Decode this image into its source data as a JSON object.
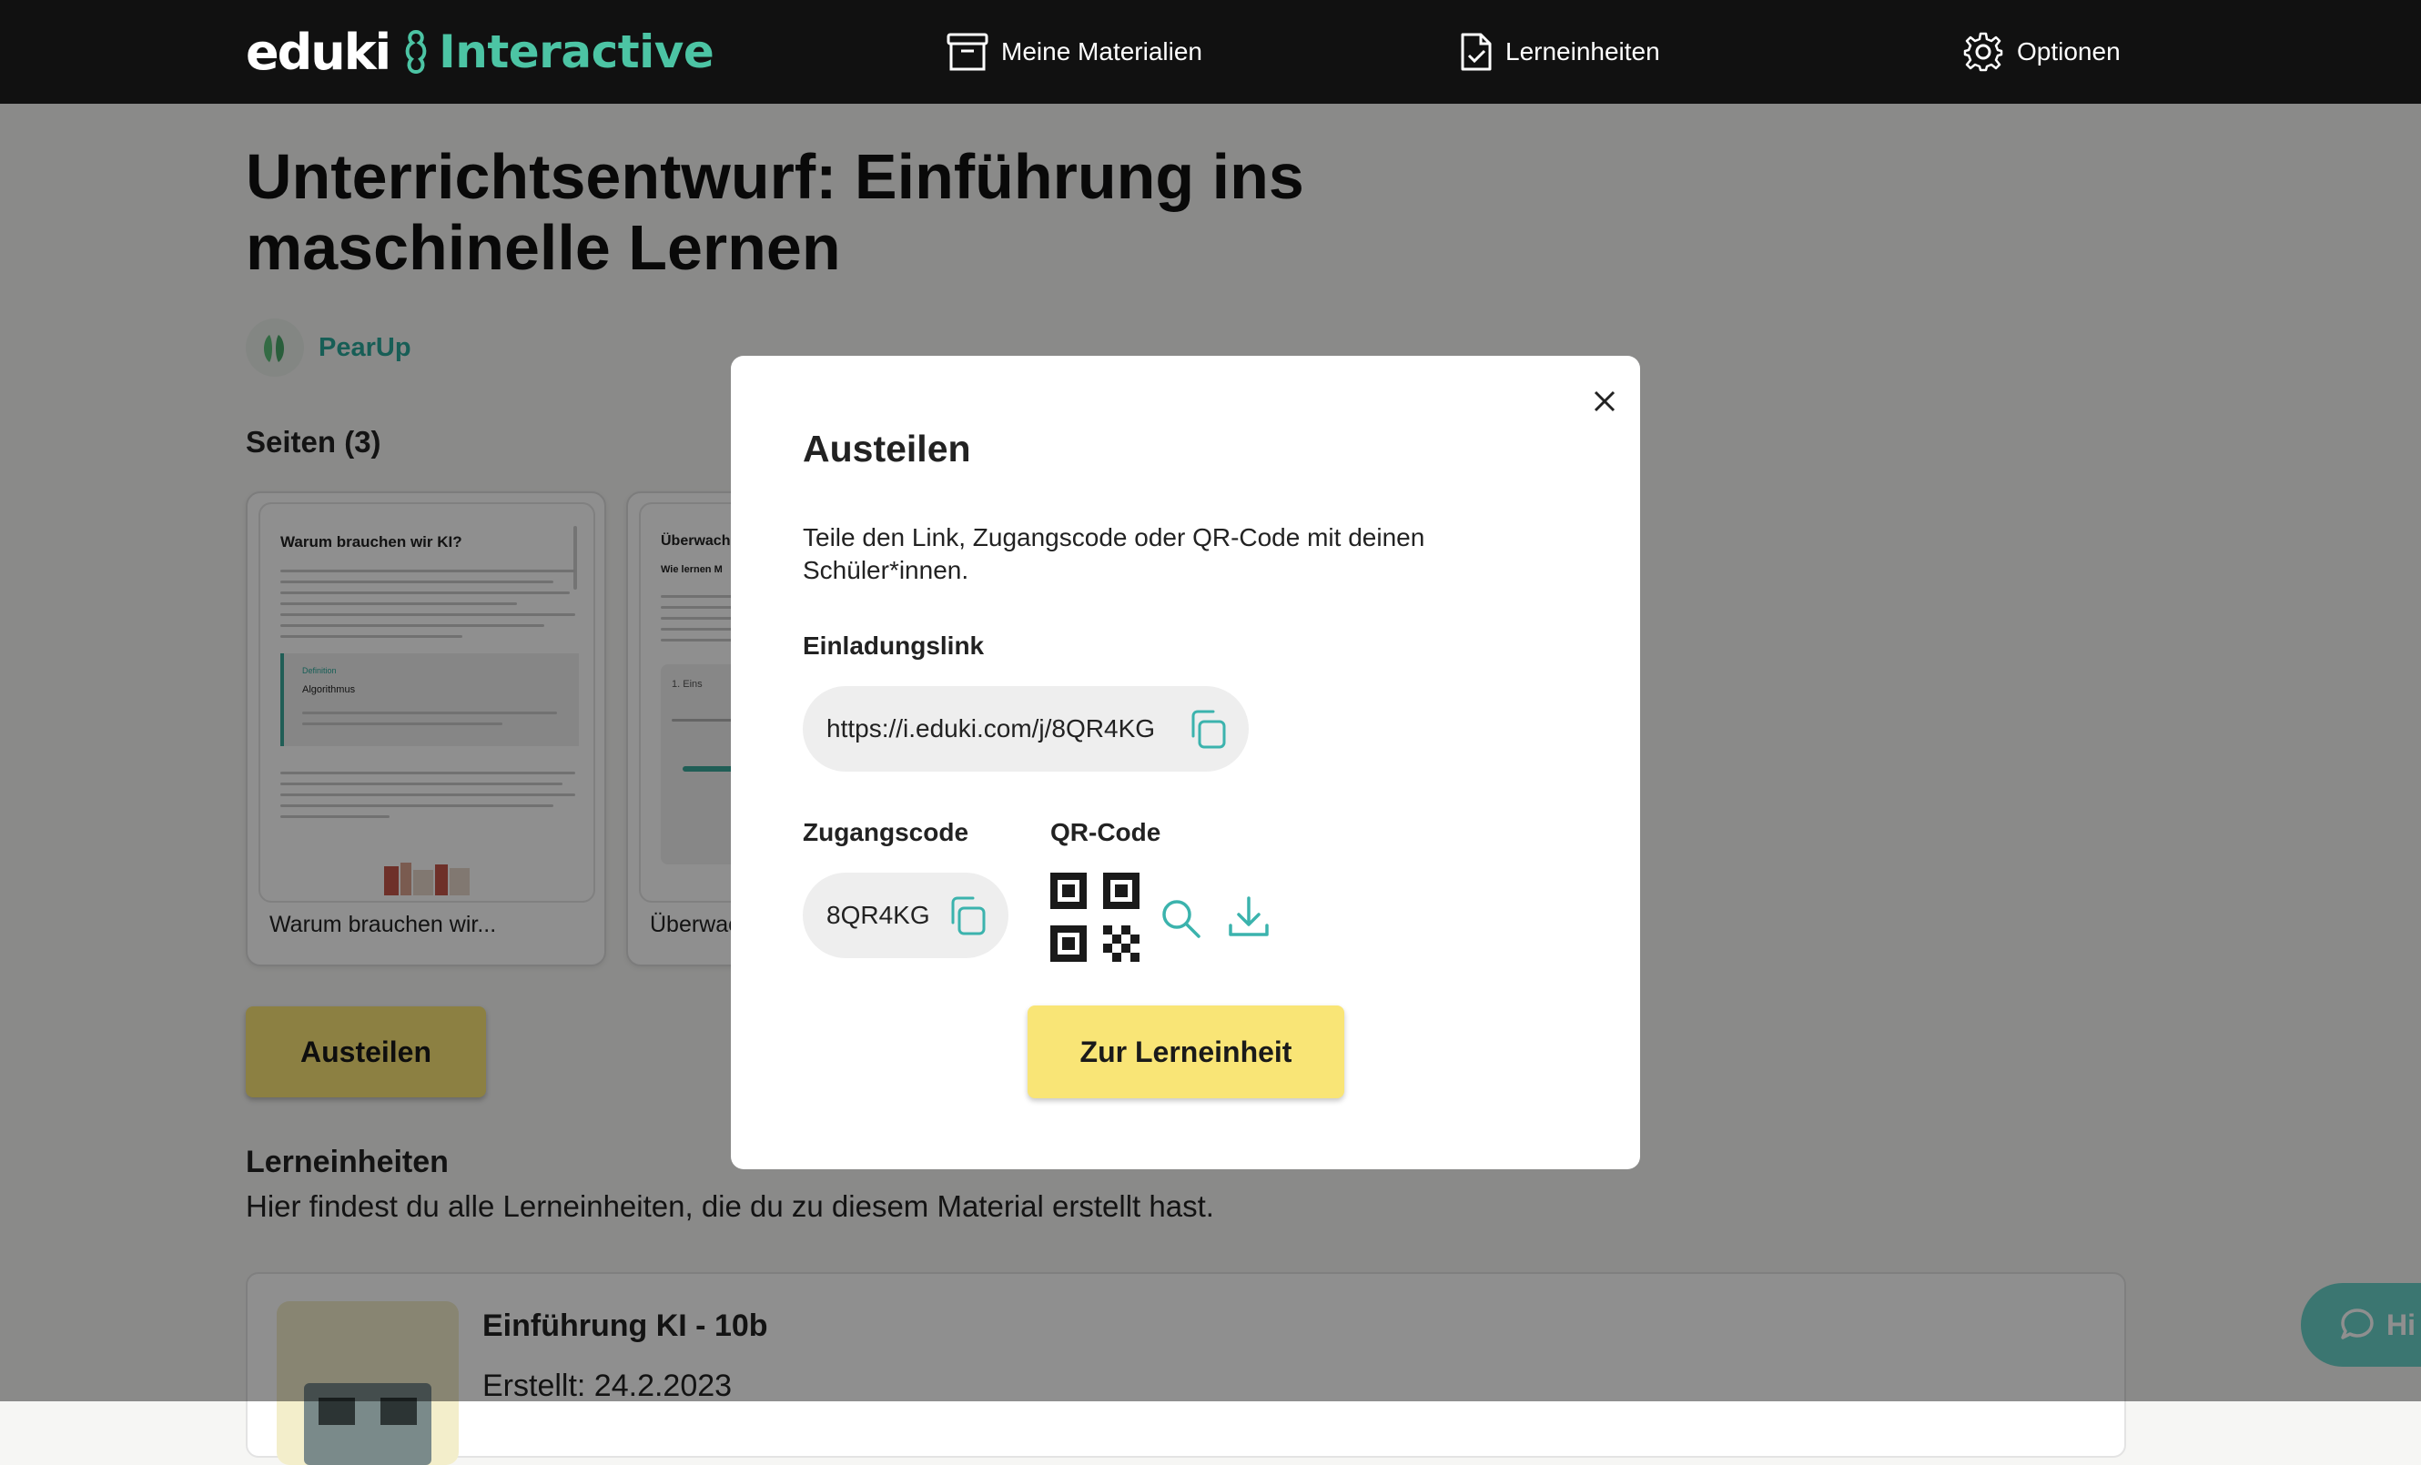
{
  "header": {
    "logo_eduki": "eduki",
    "logo_interactive": "Interactive",
    "nav": [
      {
        "label": "Meine Materialien",
        "icon": "archive-box-icon"
      },
      {
        "label": "Lerneinheiten",
        "icon": "document-check-icon"
      },
      {
        "label": "Optionen",
        "icon": "gear-icon"
      }
    ]
  },
  "page": {
    "title": "Unterrichtsentwurf: Einführung ins maschinelle Lernen",
    "author": "PearUp",
    "pages_heading": "Seiten (3)",
    "cards": [
      {
        "thumb_title": "Warum brauchen wir KI?",
        "thumb_box_label": "Definition",
        "thumb_box_title": "Algorithmus",
        "label": "Warum brauchen wir..."
      },
      {
        "thumb_title": "Überwach",
        "thumb_subtitle": "Wie lernen M",
        "thumb_step": "1. Eins",
        "label": "Überwac"
      }
    ],
    "share_button": "Austeilen",
    "lerneinheiten_heading": "Lerneinheiten",
    "lerneinheiten_desc": "Hier findest du alle Lerneinheiten, die du zu diesem Material erstellt hast.",
    "lerneinheit": {
      "title": "Einführung KI - 10b",
      "created": "Erstellt: 24.2.2023"
    },
    "help_label": "Hi"
  },
  "modal": {
    "title": "Austeilen",
    "description": "Teile den Link, Zugangscode oder QR-Code mit deinen Schüler*innen.",
    "link_label": "Einladungslink",
    "link_value": "https://i.eduki.com/j/8QR4KG",
    "code_label": "Zugangscode",
    "code_value": "8QR4KG",
    "qr_label": "QR-Code",
    "primary_button": "Zur Lerneinheit"
  },
  "colors": {
    "header_bg": "#111111",
    "brand_teal": "#4cc4a4",
    "accent_teal": "#2aa89a",
    "button_yellow": "#f9e576",
    "icon_teal": "#3bb3ad"
  }
}
